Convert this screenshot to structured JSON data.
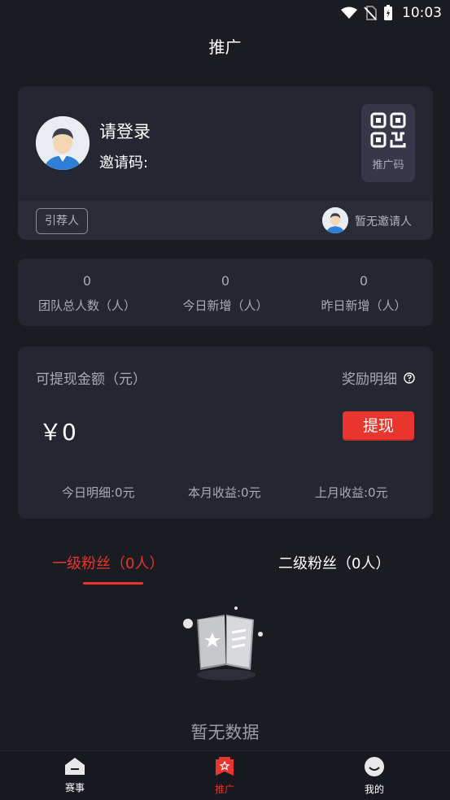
{
  "status_bar": {
    "time": "10:03"
  },
  "header": {
    "title": "推广"
  },
  "user": {
    "login_prompt": "请登录",
    "invite_code_label": "邀请码:",
    "qr_label": "推广码",
    "referrer_button": "引荐人",
    "no_inviter": "暂无邀请人"
  },
  "stats": [
    {
      "value": "0",
      "label": "团队总人数（人）"
    },
    {
      "value": "0",
      "label": "今日新增（人）"
    },
    {
      "value": "0",
      "label": "昨日新增（人）"
    }
  ],
  "wallet": {
    "withdrawable_label": "可提现金额（元）",
    "reward_detail": "奖励明细",
    "amount": "￥0",
    "withdraw_button": "提现",
    "today_detail": "今日明细:0元",
    "month_income": "本月收益:0元",
    "last_month_income": "上月收益:0元"
  },
  "tabs": [
    {
      "label": "一级粉丝（0人）",
      "active": true
    },
    {
      "label": "二级粉丝（0人）",
      "active": false
    }
  ],
  "empty_state": {
    "text": "暂无数据"
  },
  "bottom_nav": [
    {
      "label": "赛事",
      "icon": "home-icon"
    },
    {
      "label": "推广",
      "icon": "promote-icon"
    },
    {
      "label": "我的",
      "icon": "profile-icon"
    }
  ],
  "colors": {
    "accent": "#e8352d",
    "background": "#1b1c22",
    "card": "#242631"
  }
}
